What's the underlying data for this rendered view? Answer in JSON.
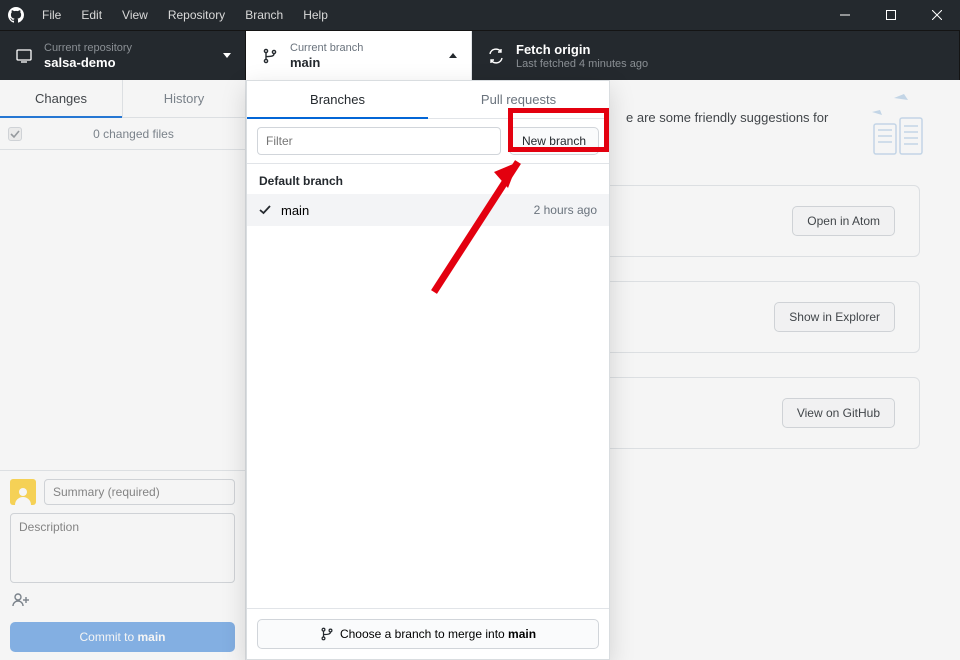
{
  "menu": {
    "items": [
      "File",
      "Edit",
      "View",
      "Repository",
      "Branch",
      "Help"
    ]
  },
  "toolbar": {
    "repo_label": "Current repository",
    "repo_name": "salsa-demo",
    "branch_label": "Current branch",
    "branch_name": "main",
    "fetch_title": "Fetch origin",
    "fetch_sub": "Last fetched 4 minutes ago"
  },
  "sidebar": {
    "tabs": {
      "changes": "Changes",
      "history": "History"
    },
    "files_count": "0 changed files",
    "summary_placeholder": "Summary (required)",
    "desc_placeholder": "Description",
    "commit_prefix": "Commit to ",
    "commit_branch": "main"
  },
  "dropdown": {
    "tabs": {
      "branches": "Branches",
      "pulls": "Pull requests"
    },
    "filter_placeholder": "Filter",
    "new_branch": "New branch",
    "default_label": "Default branch",
    "item_name": "main",
    "item_time": "2 hours ago",
    "merge_prefix": "Choose a branch to merge into ",
    "merge_target": "main"
  },
  "main": {
    "suggestion_tail": "e are some friendly suggestions for",
    "btn_atom": "Open in Atom",
    "btn_explorer": "Show in Explorer",
    "btn_github": "View on GitHub"
  }
}
